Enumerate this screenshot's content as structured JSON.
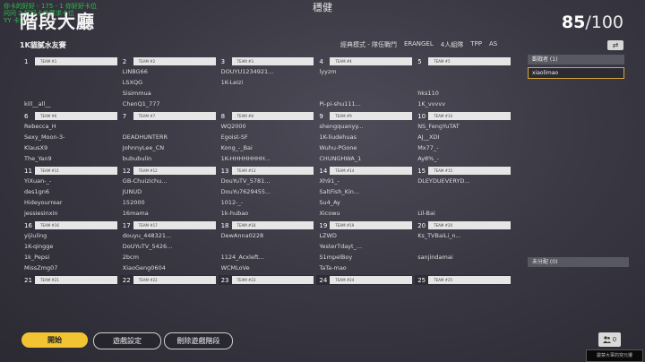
{
  "overlay": {
    "line1": "你卡的好好 - 175 - 1 你好好卡位",
    "line2": "问问 2 好好卡位要求卡位",
    "line3": "YY 卡位"
  },
  "header": {
    "title": "階段大廳",
    "center": "穩健",
    "count": "85",
    "max": "/100"
  },
  "room": {
    "name": "1K貓膩水友賽",
    "mode": "經典模式 - 隊伍戰鬥",
    "map": "ERANGEL",
    "squad": "4人組隊",
    "perspective": "TPP",
    "region": "AS"
  },
  "teams": [
    {
      "num": "1",
      "label": "TEAM #1",
      "players": [
        "",
        "",
        "",
        "kill__all__"
      ]
    },
    {
      "num": "2",
      "label": "TEAM #2",
      "players": [
        "LINBG66",
        "LSXQG",
        "Sisimmua",
        "ChenQ1_777"
      ]
    },
    {
      "num": "3",
      "label": "TEAM #3",
      "players": [
        "DOUYU1234921...",
        "1K-Leizi",
        "",
        ""
      ]
    },
    {
      "num": "4",
      "label": "TEAM #4",
      "players": [
        "lyyzm",
        "",
        "",
        "Pi-pi-shu111..."
      ]
    },
    {
      "num": "5",
      "label": "TEAM #5",
      "players": [
        "",
        "",
        "hks110",
        "1K_vvvvv"
      ]
    },
    {
      "num": "6",
      "label": "TEAM #6",
      "players": [
        "Rebecca_H",
        "Sexy_Moon-3-",
        "KlausX9",
        "The_Yan9"
      ]
    },
    {
      "num": "7",
      "label": "TEAM #7",
      "players": [
        "",
        "DEADHUNTERR",
        "JohnnyLee_CN",
        "bububulin"
      ]
    },
    {
      "num": "8",
      "label": "TEAM #8",
      "players": [
        "WQ2000",
        "Egoist-SF",
        "Kong_-_Bai",
        "1K-HHHHHHHH..."
      ]
    },
    {
      "num": "9",
      "label": "TEAM #9",
      "players": [
        "shengquanyy...",
        "1K-liudehuas",
        "Wuhu-PGone",
        "CHUNGHWA_1"
      ]
    },
    {
      "num": "10",
      "label": "TEAM #10",
      "players": [
        "NS_FengYuTAT",
        "AJ__XDI",
        "Mx77_-",
        "Ay8%_-"
      ]
    },
    {
      "num": "11",
      "label": "TEAM #11",
      "players": [
        "YiXuan-_-",
        "des1gn6",
        "Hideyourrear",
        "jessiesinxin"
      ]
    },
    {
      "num": "12",
      "label": "TEAM #12",
      "players": [
        "GB-Chuizichu...",
        "JUNUD",
        "152000",
        "16mama"
      ]
    },
    {
      "num": "13",
      "label": "TEAM #13",
      "players": [
        "DouYuTV_5781...",
        "DouYu7629455...",
        "1012-_-",
        "1k-hubao"
      ]
    },
    {
      "num": "14",
      "label": "TEAM #14",
      "players": [
        "Xh91_-",
        "SaltFish_Kin...",
        "Su4_Ay",
        "Xicowu"
      ]
    },
    {
      "num": "15",
      "label": "TEAM #15",
      "players": [
        "DLEYDUEVERYD...",
        "",
        "",
        "Lil-Bai"
      ]
    },
    {
      "num": "16",
      "label": "TEAM #16",
      "players": [
        "yijiuling",
        "1K-qingge",
        "1k_Pepsi",
        "MissZmg07"
      ]
    },
    {
      "num": "17",
      "label": "TEAM #17",
      "players": [
        "douyu_448321...",
        "DoUYuTV_5426...",
        "2bcm",
        "XiaoGeng0604"
      ]
    },
    {
      "num": "18",
      "label": "TEAM #18",
      "players": [
        "DewAnna0228",
        "",
        "1124_Acxleft...",
        "WCMLoVe"
      ]
    },
    {
      "num": "19",
      "label": "TEAM #19",
      "players": [
        "LZWD",
        "YesterTdayt_...",
        "S1mpelBoy",
        "TaTa-mao"
      ]
    },
    {
      "num": "20",
      "label": "TEAM #20",
      "players": [
        "Ks_TVBaiLi_n...",
        "",
        "sanjindamai",
        ""
      ]
    },
    {
      "num": "21",
      "label": "TEAM #21",
      "players": []
    },
    {
      "num": "22",
      "label": "TEAM #22",
      "players": []
    },
    {
      "num": "23",
      "label": "TEAM #23",
      "players": []
    },
    {
      "num": "24",
      "label": "TEAM #24",
      "players": []
    },
    {
      "num": "25",
      "label": "TEAM #25",
      "players": []
    }
  ],
  "side": {
    "observers_label": "觀戰者 (1)",
    "observer": "xiaolimao",
    "unassigned_label": "未分配 (0)",
    "swap_icon": "⇄"
  },
  "buttons": {
    "start": "開始",
    "settings": "遊戲設定",
    "delete": "刪除遊戲階段",
    "friends_count": "0"
  },
  "watermark": "嚴禁大軍的突元樓"
}
